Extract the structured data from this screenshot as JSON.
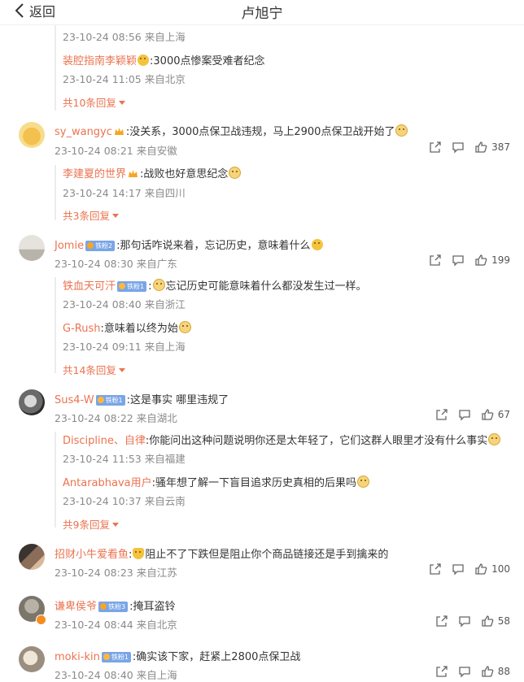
{
  "header": {
    "back_label": "返回",
    "title": "卢旭宁"
  },
  "top_thread": {
    "replies": [
      {
        "meta": "23-10-24 08:56 来自上海"
      },
      {
        "user": "装腔指南李颖颖",
        "text": ":3000点惨案受难者纪念",
        "meta": "23-10-24 11:05 来自北京"
      }
    ],
    "more": "共10条回复"
  },
  "comments": [
    {
      "user": "sy_wangyc",
      "text": ":没关系，3000点保卫战违规，马上2900点保卫战开始了",
      "meta": "23-10-24 08:21 来自安徽",
      "likes": "387",
      "replies": [
        {
          "user": "李建夏的世界",
          "text": ":战败也好意思纪念",
          "meta": "23-10-24 14:17 来自四川"
        }
      ],
      "more": "共3条回复"
    },
    {
      "user": "Jomie",
      "badge": "铁粉2",
      "text": ":那句话咋说来着，忘记历史，意味着什么",
      "meta": "23-10-24 08:30 来自广东",
      "likes": "199",
      "replies": [
        {
          "user": "铁血天可汗",
          "badge": "铁粉1",
          "text": "忘记历史可能意味着什么都没发生过一样。",
          "meta": "23-10-24 08:40 来自浙江"
        },
        {
          "user": "G-Rush",
          "text": ":意味着以终为始",
          "meta": "23-10-24 09:11 来自上海"
        }
      ],
      "more": "共14条回复"
    },
    {
      "user": "Sus4-W",
      "badge": "铁粉1",
      "text": ":这是事实 哪里违规了",
      "meta": "23-10-24 08:22 来自湖北",
      "likes": "67",
      "replies": [
        {
          "user": "Discipline、自律",
          "text": ":你能问出这种问题说明你还是太年轻了，它们这群人眼里才没有什么事实",
          "meta": "23-10-24 11:53 来自福建"
        },
        {
          "user": "Antarabhava用户",
          "text": ":骚年想了解一下盲目追求历史真相的后果吗",
          "meta": "23-10-24 10:37 来自云南"
        }
      ],
      "more": "共9条回复"
    },
    {
      "user": "招财小牛爱看鱼",
      "text": "阻止不了下跌但是阻止你个商品链接还是手到擒来的",
      "meta": "23-10-24 08:23 来自江苏",
      "likes": "100"
    },
    {
      "user": "谦卑侯爷",
      "badge": "铁粉3",
      "text": ":掩耳盗铃",
      "meta": "23-10-24 08:44 来自北京",
      "likes": "58"
    },
    {
      "user": "moki-kin",
      "badge": "铁粉1",
      "text": ":确实该下家，赶紧上2800点保卫战",
      "meta": "23-10-24 08:40 来自上海",
      "likes": "88"
    }
  ],
  "colors": {
    "accent": "#eb7350",
    "meta": "#8a8a8a",
    "text": "#333333",
    "badge": "#79a5e6"
  }
}
